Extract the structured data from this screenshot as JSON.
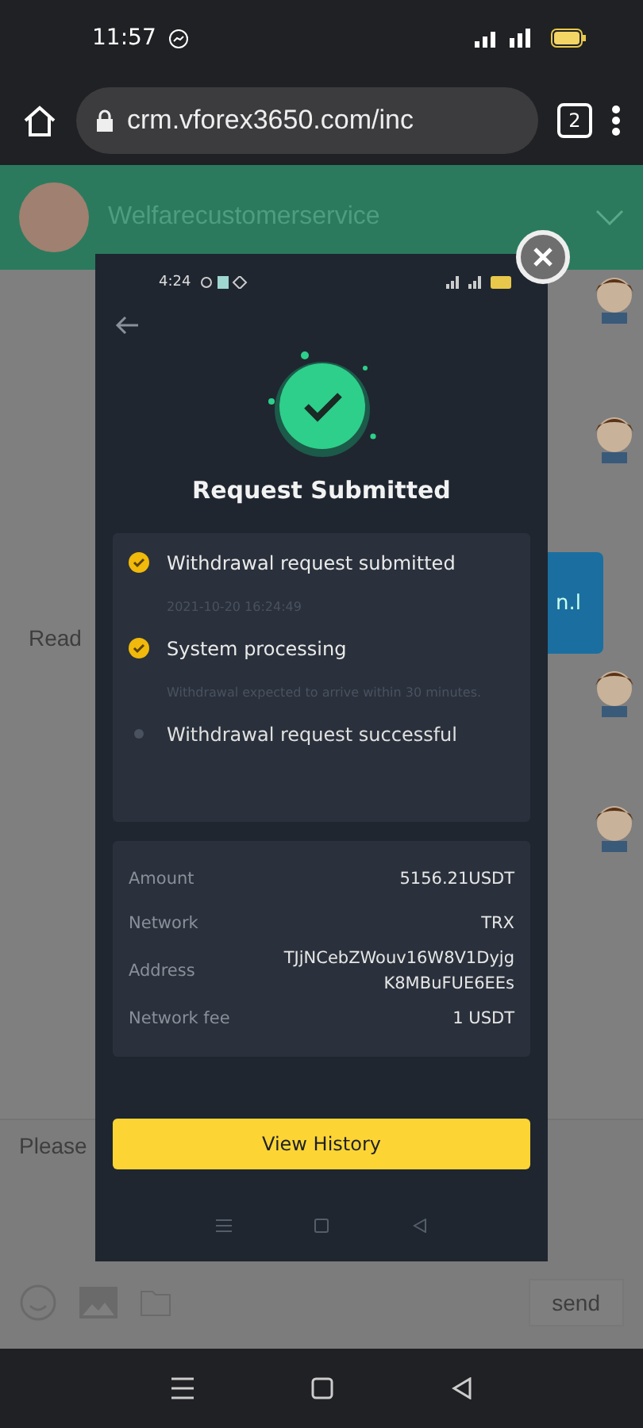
{
  "status_bar": {
    "time": "11:57"
  },
  "browser": {
    "url": "crm.vforex3650.com/inc",
    "tab_count": "2"
  },
  "chat": {
    "contact": "Welfarecustomerservice",
    "partial_message": "Read",
    "bubble_text": "n.l",
    "input": {
      "placeholder": "Please"
    },
    "send_label": "send"
  },
  "modal": {
    "status_time": "4:24",
    "title": "Request Submitted",
    "steps": [
      {
        "label": "Withdrawal request submitted",
        "detail": "2021-10-20 16:24:49",
        "done": true
      },
      {
        "label": "System processing",
        "detail": "Withdrawal expected to arrive within 30 minutes.",
        "done": true
      },
      {
        "label": "Withdrawal request successful",
        "done": false
      }
    ],
    "details": [
      {
        "label": "Amount",
        "value": "5156.21USDT"
      },
      {
        "label": "Network",
        "value": "TRX"
      },
      {
        "label": "Address",
        "value": "TJjNCebZWouv16W8V1DyjgK8MBuFUE6EEs"
      },
      {
        "label": "Network fee",
        "value": "1 USDT"
      }
    ],
    "button": "View History"
  }
}
